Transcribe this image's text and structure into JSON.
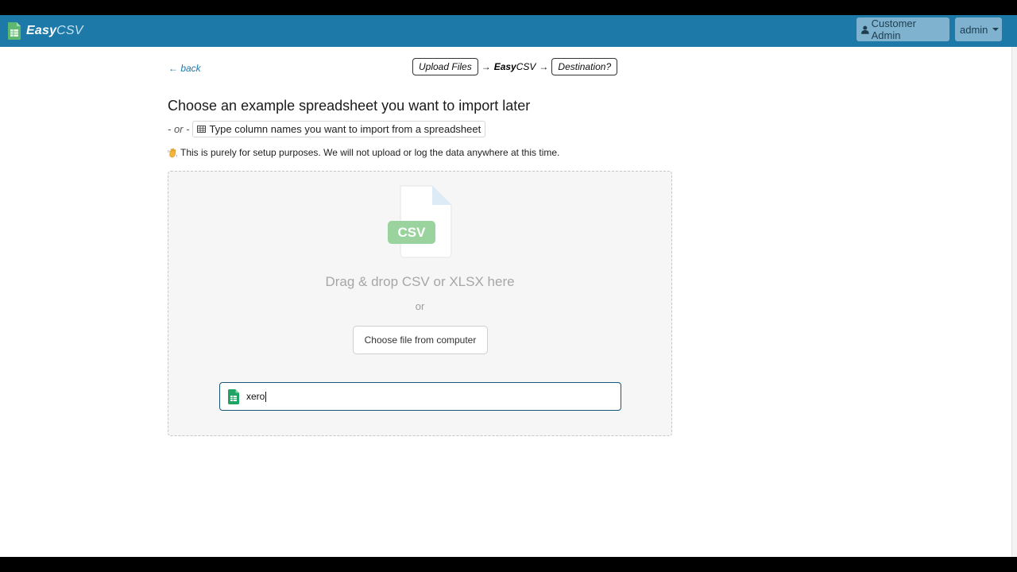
{
  "app": {
    "brand_part1": "Easy",
    "brand_part2": "CSV"
  },
  "navbar": {
    "customer_admin_label": "Customer Admin",
    "admin_menu_label": "admin"
  },
  "back_link": "← back",
  "steps": {
    "step1": "Upload Files",
    "arrow": "→",
    "step2_bold": "Easy",
    "step2_rest": "CSV",
    "step3": "Destination?"
  },
  "main": {
    "heading": "Choose an example spreadsheet you want to import later",
    "or_text": "- or -",
    "type_columns_label": "Type column names you want to import from a spreadsheet",
    "note": "This is purely for setup purposes. We will not upload or log the data anywhere at this time."
  },
  "dropzone": {
    "file_badge": "CSV",
    "drag_text": "Drag & drop CSV or XLSX here",
    "or_text": "or",
    "choose_button": "Choose file from computer",
    "sheet_input_value": "xero"
  },
  "colors": {
    "navbar": "#1c79a8",
    "nav_button": "#7fb2cf",
    "accent_link": "#1c79a8",
    "csv_badge": "#9ad39d",
    "input_border": "#16587a",
    "google_sheets_green": "#1fa463"
  },
  "icons": {
    "brand": "spreadsheet-logo-icon",
    "user": "user-icon",
    "menu": "caret-down-icon",
    "table": "table-icon",
    "note": "waving-hand-icon",
    "file": "csv-file-icon",
    "input": "google-sheets-icon"
  }
}
